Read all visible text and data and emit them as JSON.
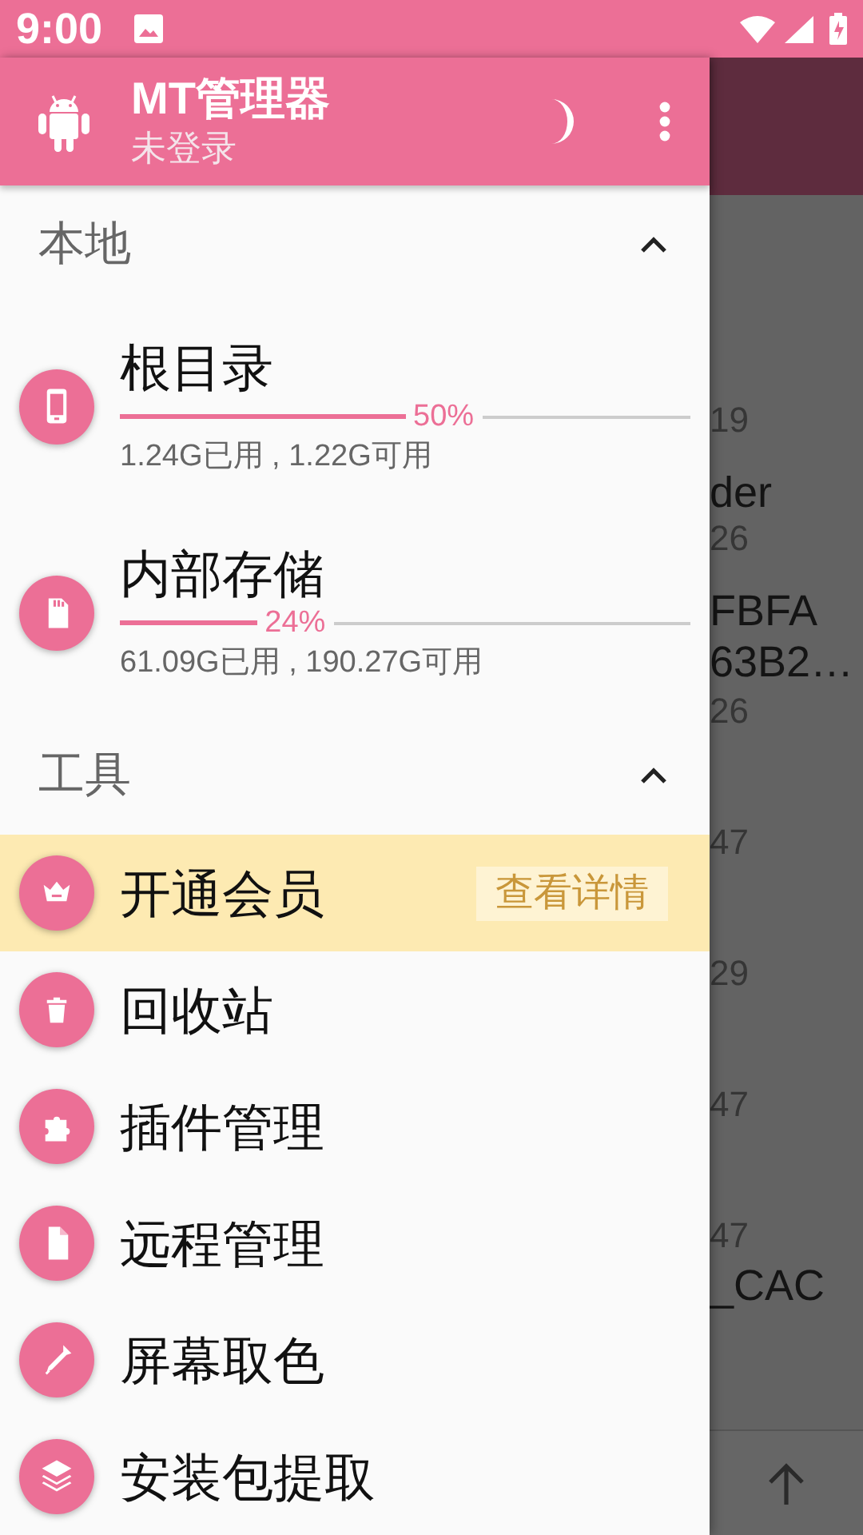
{
  "status_bar": {
    "time": "9:00"
  },
  "header": {
    "title": "MT管理器",
    "subtitle": "未登录"
  },
  "sections": [
    {
      "title": "本地",
      "expanded": true,
      "items": [
        {
          "kind": "storage",
          "name": "根目录",
          "level": 0.5,
          "percent": "50%",
          "usage": "1.24G已用 , 1.22G可用"
        },
        {
          "kind": "storage",
          "name": "内部存储",
          "level": 0.24,
          "percent": "24%",
          "usage": "61.09G已用 , 190.27G可用"
        }
      ]
    },
    {
      "title": "工具",
      "expanded": true,
      "items": [
        {
          "kind": "tool",
          "name": "开通会员",
          "highlighted": true,
          "badge": "查看详情"
        },
        {
          "kind": "tool",
          "name": "回收站",
          "highlighted": false
        },
        {
          "kind": "tool",
          "name": "插件管理",
          "highlighted": false
        },
        {
          "kind": "tool",
          "name": "远程管理",
          "highlighted": false
        },
        {
          "kind": "tool",
          "name": "屏幕取色",
          "highlighted": false
        },
        {
          "kind": "tool",
          "name": "安装包提取",
          "highlighted": false
        }
      ]
    }
  ],
  "background": {
    "fragments": [
      {
        "kind": "date",
        "text": "19"
      },
      {
        "kind": "name",
        "text": "der"
      },
      {
        "kind": "date",
        "text": "26"
      },
      {
        "kind": "name",
        "text": "FBFA"
      },
      {
        "kind": "name",
        "text": "63B2…"
      },
      {
        "kind": "date",
        "text": "26"
      },
      {
        "kind": "date",
        "text": "47"
      },
      {
        "kind": "date",
        "text": "29"
      },
      {
        "kind": "date",
        "text": "47"
      },
      {
        "kind": "date",
        "text": "47"
      },
      {
        "kind": "name",
        "text": "_CAC"
      }
    ]
  }
}
